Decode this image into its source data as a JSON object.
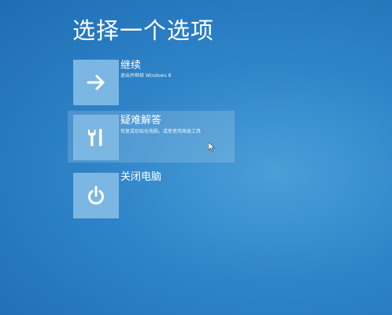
{
  "screen": {
    "title": "选择一个选项"
  },
  "options": [
    {
      "title": "继续",
      "description": "退出并继续 Windows 8",
      "icon": "arrow-right-icon"
    },
    {
      "title": "疑难解答",
      "description": "恢复或初始化电脑，或者使用高级工具",
      "icon": "tools-icon"
    },
    {
      "title": "关闭电脑",
      "description": "",
      "icon": "power-icon"
    }
  ],
  "colors": {
    "background": "#2f84c8",
    "tile": "#7cb7e3",
    "highlight": "rgba(255,255,255,0.16)"
  }
}
